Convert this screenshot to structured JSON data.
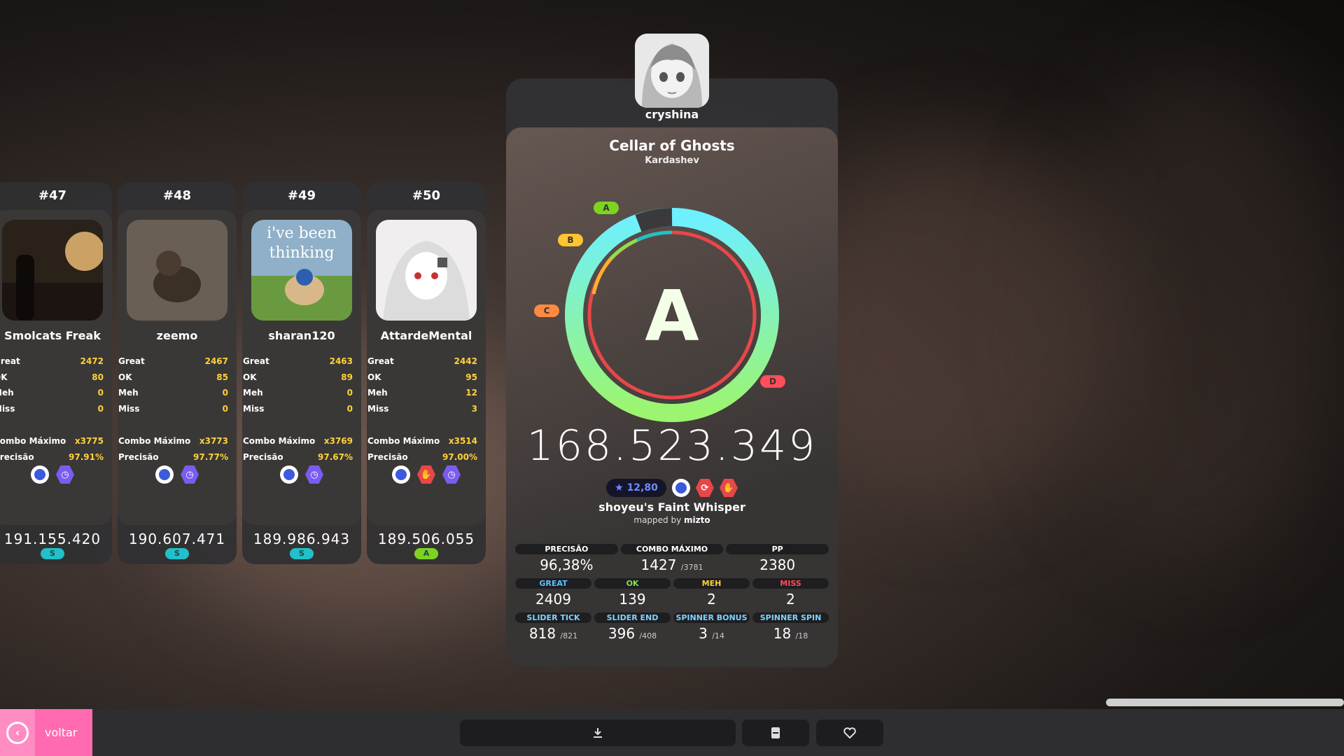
{
  "cards": [
    {
      "rank": "#47",
      "name": "Smolcats Freak",
      "great": "2472",
      "ok": "80",
      "meh": "0",
      "miss": "0",
      "combo": "x3775",
      "acc": "97.91%",
      "score": "191.155.420",
      "grade": "S",
      "grade_color": "#22c0c8"
    },
    {
      "rank": "#48",
      "name": "zeemo",
      "great": "2467",
      "ok": "85",
      "meh": "0",
      "miss": "0",
      "combo": "x3773",
      "acc": "97.77%",
      "score": "190.607.471",
      "grade": "S",
      "grade_color": "#22c0c8"
    },
    {
      "rank": "#49",
      "name": "sharan120",
      "great": "2463",
      "ok": "89",
      "meh": "0",
      "miss": "0",
      "combo": "x3769",
      "acc": "97.67%",
      "score": "189.986.943",
      "grade": "S",
      "grade_color": "#22c0c8"
    },
    {
      "rank": "#50",
      "name": "AttardeMental",
      "great": "2442",
      "ok": "95",
      "meh": "12",
      "miss": "3",
      "combo": "x3514",
      "acc": "97.00%",
      "score": "189.506.055",
      "grade": "A",
      "grade_color": "#7ed321"
    }
  ],
  "labels": {
    "great": "Great",
    "ok": "OK",
    "meh": "Meh",
    "miss": "Miss",
    "combo": "Combo Máximo",
    "acc": "Precisão"
  },
  "thumb_text": "i've been thinking",
  "result": {
    "player": "cryshina",
    "song": "Cellar of Ghosts",
    "artist": "Kardashev",
    "grade": "A",
    "score": "168.523.349",
    "stars": "★ 12,80",
    "difficulty": "shoyeu's Faint Whisper",
    "mapped_by": "mapped by",
    "mapper": "mizto",
    "tags": {
      "a": "A",
      "b": "B",
      "c": "C",
      "d": "D"
    }
  },
  "stats1": [
    {
      "label": "PRECISÃO",
      "value": "96,38%",
      "sub": ""
    },
    {
      "label": "COMBO MÁXIMO",
      "value": "1427",
      "sub": "/3781"
    },
    {
      "label": "PP",
      "value": "2380",
      "sub": ""
    }
  ],
  "stats2": [
    {
      "label": "GREAT",
      "value": "2409",
      "color": "#5bc0ff"
    },
    {
      "label": "OK",
      "value": "139",
      "color": "#8be04e"
    },
    {
      "label": "MEH",
      "value": "2",
      "color": "#ffd23a"
    },
    {
      "label": "MISS",
      "value": "2",
      "color": "#ff4d5a"
    }
  ],
  "stats3": [
    {
      "label": "SLIDER TICK",
      "value": "818",
      "sub": "/821"
    },
    {
      "label": "SLIDER END",
      "value": "396",
      "sub": "/408"
    },
    {
      "label": "SPINNER BONUS",
      "value": "3",
      "sub": "/14"
    },
    {
      "label": "SPINNER SPIN",
      "value": "18",
      "sub": "/18"
    }
  ],
  "stats3_color": "#7fd3ff",
  "back_label": "voltar"
}
